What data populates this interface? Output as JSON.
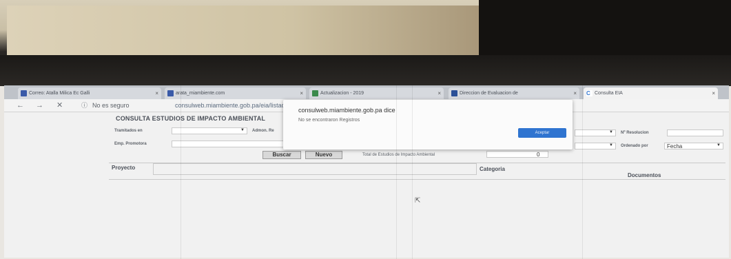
{
  "tabs": [
    {
      "label": "Correo: Atalla Milica Ec Galli"
    },
    {
      "label": "arata_miambiente.com"
    },
    {
      "label": "Actualizacion - 2019"
    },
    {
      "label": "Direccion de Evaluacion de"
    },
    {
      "label": "Consulta EIA"
    }
  ],
  "address": {
    "security": "No es seguro",
    "url": "consulweb.miambiente.gob.pa/eia/listado.aspx"
  },
  "page": {
    "title": "CONSULTA ESTUDIOS DE IMPACTO AMBIENTAL",
    "filters": {
      "tramitados_label": "Tramitados en",
      "admon_label": "Admon. Re",
      "emp_label": "Emp. Promotora",
      "resolucion_label": "Nº Resolucion",
      "ordenado_label": "Ordenado por",
      "ordenado_value": "Fecha"
    },
    "buttons": {
      "buscar": "Buscar",
      "nuevo": "Nuevo"
    },
    "total_label": "Total de Estudios de Impacto Ambiental",
    "total_value": "0",
    "columns": {
      "proyecto": "Proyecto",
      "categoria": "Categoria",
      "documentos": "Documentos"
    }
  },
  "dialog": {
    "title": "consulweb.miambiente.gob.pa dice",
    "message": "No se encontraron Registros",
    "button": "Aceptar"
  }
}
